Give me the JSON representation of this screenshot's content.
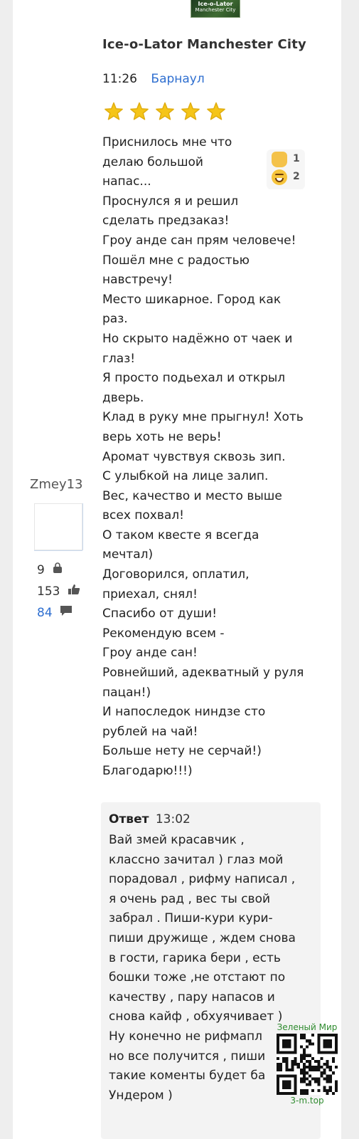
{
  "product": {
    "thumbnail_text_1": "Ice-o-Lator",
    "thumbnail_text_2": "Manchester City",
    "title": "Ice-o-Lator Manchester City"
  },
  "review": {
    "time": "11:26",
    "city": "Барнаул",
    "rating": 5,
    "rating_max": 5,
    "star_color": "#f5c518",
    "reactions": [
      {
        "icon": "raised-fist-emoji-icon",
        "count": "1"
      },
      {
        "icon": "laughing-emoji-icon",
        "count": "2"
      }
    ],
    "lines": [
      "Приснилось мне что",
      "делаю большой",
      "напас...",
      "Проснулся я и решил",
      "сделать предзаказ!",
      "Гроу анде сан прям человече!",
      "Пошёл мне с радостью",
      "навстречу!",
      "Место шикарное. Город как",
      "раз.",
      "Но скрыто надёжно от чаек и",
      "глаз!",
      "Я просто подьехал и открыл",
      "дверь.",
      "Клад в руку мне прыгнул! Хоть",
      "верь хоть не верь!",
      "Аромат чувствуя сквозь зип.",
      "С улыбкой на лице залип.",
      "Вес, качество и место выше",
      "всех похвал!",
      "О таком квесте я всегда",
      "мечтал)",
      "Договорился, оплатил,",
      "приехал, снял!",
      "Спасибо от души!",
      "Рекомендую всем -",
      "Гроу анде сан!",
      "Ровнейший, адекватный у руля",
      "пацан!)",
      "И напоследок ниндзе сто",
      "рублей на чай!",
      "Больше нету не серчай!)",
      "Благодарю!!!)"
    ]
  },
  "author": {
    "name": "Zmey13",
    "purchases": "9",
    "likes": "153",
    "comments": "84",
    "link_color": "#2f6fd0"
  },
  "answer": {
    "label": "Ответ",
    "time": "13:02",
    "lines": [
      "Вай змей красавчик ,",
      "классно зачитал ) глаз мой",
      "порадовал , рифму написал ,",
      "я очень рад , вес ты свой",
      "забрал . Пиши-кури кури-",
      "пиши дружище , ждем снова",
      "в гости, гарика бери , есть",
      "бошки тоже ,не отстают по",
      "качеству , пару напасов и",
      "снова кайф , обхуячивает )",
      "Ну конечно не рифмапл",
      "но все получится , пиши",
      "такие коменты будет ба",
      "Ундером )"
    ]
  },
  "watermark": {
    "top": "Зеленый Мир",
    "bottom": "3-m.top"
  }
}
